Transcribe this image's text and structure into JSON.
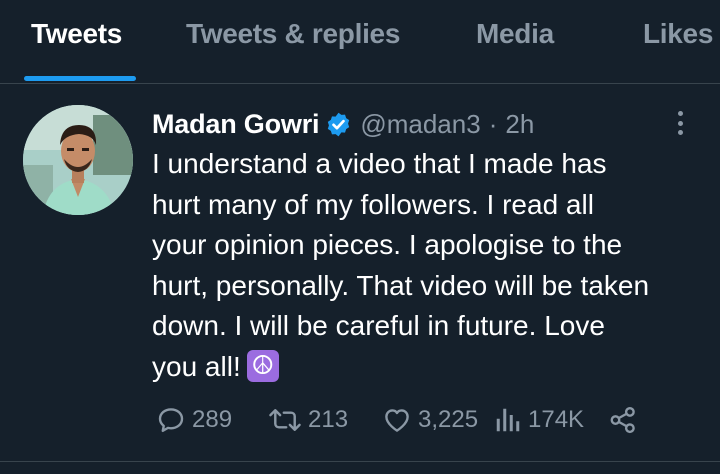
{
  "tabs": [
    {
      "label": "Tweets",
      "active": true
    },
    {
      "label": "Tweets & replies",
      "active": false
    },
    {
      "label": "Media",
      "active": false
    },
    {
      "label": "Likes",
      "active": false
    }
  ],
  "tweet": {
    "display_name": "Madan Gowri",
    "verified": true,
    "handle": "@madan3",
    "separator": "·",
    "time": "2h",
    "text_lines": [
      "I understand a video that I made has",
      "hurt many of my followers. I read all",
      "your opinion pieces. I apologise to the",
      "hurt, personally. That video will be taken",
      "down. I will be careful in future. Love",
      "you all!"
    ],
    "emoji": "☮",
    "replies": "289",
    "retweets": "213",
    "likes": "3,225",
    "views": "174K"
  },
  "colors": {
    "background": "#15202b",
    "accent": "#1d9bf0",
    "secondary_text": "#8b98a5",
    "emoji_bg": "#9b6ce0"
  },
  "icons": [
    "verified-badge-icon",
    "more-options-icon",
    "reply-icon",
    "retweet-icon",
    "like-icon",
    "views-icon",
    "share-icon",
    "peace-symbol-icon"
  ]
}
